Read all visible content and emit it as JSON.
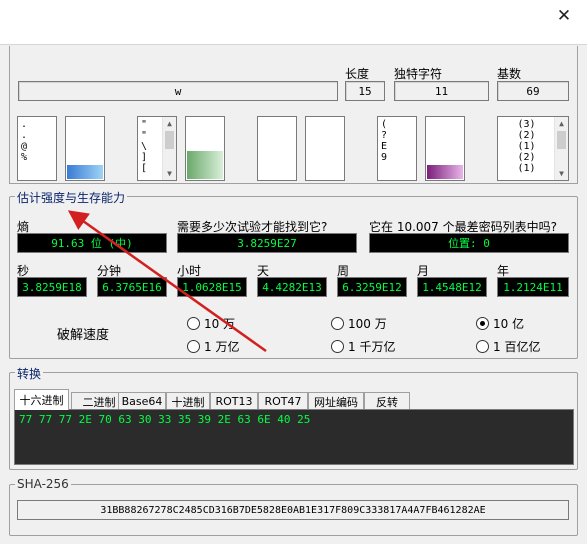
{
  "window": {
    "close_glyph": "✕"
  },
  "top": {
    "input_value": "w",
    "length_label": "长度",
    "length_value": "15",
    "unique_label": "独特字符",
    "unique_value": "11",
    "base_label": "基数",
    "base_value": "69",
    "charbox1": [
      ".",
      ".",
      "@",
      "%"
    ],
    "charbox2": [
      "\"",
      "\"",
      "\\",
      "]",
      "["
    ],
    "charbox3": [
      "(",
      "?",
      "E",
      "9"
    ],
    "charbox4": [
      "(3)",
      "(2)",
      "(1)",
      "(2)",
      "(1)"
    ]
  },
  "strength": {
    "title": "估计强度与生存能力",
    "entropy_label": "熵",
    "entropy_value": "91.63 位 (中)",
    "attempts_label": "需要多少次试验才能找到它?",
    "attempts_value": "3.8259E27",
    "list_label": "它在 10.007 个最差密码列表中吗?",
    "list_value": "位置: 0",
    "times": [
      {
        "label": "秒",
        "value": "3.8259E18"
      },
      {
        "label": "分钟",
        "value": "6.3765E16"
      },
      {
        "label": "小时",
        "value": "1.0628E15"
      },
      {
        "label": "天",
        "value": "4.4282E13"
      },
      {
        "label": "周",
        "value": "6.3259E12"
      },
      {
        "label": "月",
        "value": "1.4548E12"
      },
      {
        "label": "年",
        "value": "1.2124E11"
      }
    ],
    "speed_label": "破解速度",
    "speeds": [
      {
        "label": "10 万",
        "checked": false
      },
      {
        "label": "100 万",
        "checked": false
      },
      {
        "label": "10 亿",
        "checked": true
      },
      {
        "label": "1 万亿",
        "checked": false
      },
      {
        "label": "1 千万亿",
        "checked": false
      },
      {
        "label": "1 百亿亿",
        "checked": false
      }
    ]
  },
  "convert": {
    "title": "转换",
    "tabs": [
      "十六进制",
      "二进制",
      "Base64",
      "十进制",
      "ROT13",
      "ROT47",
      "网址编码",
      "反转"
    ],
    "active_tab": 0,
    "output": "77 77 77 2E 70 63 30 33 35 39 2E 63 6E 40 25"
  },
  "sha": {
    "title": "SHA-256",
    "value": "31BB88267278C2485CD316B7DE5828E0AB1E317F809C333817A4A7FB461282AE"
  },
  "colors": {
    "group_title": "#0a246a",
    "field_text": "#00ff40",
    "arrow": "#d22020"
  }
}
